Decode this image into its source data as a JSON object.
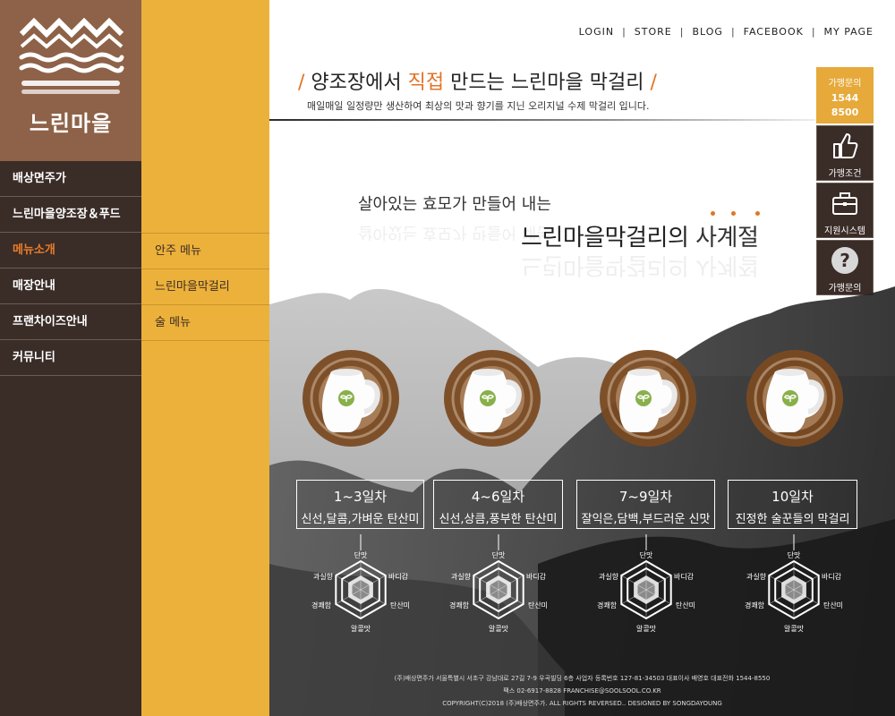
{
  "brand": {
    "logo_text": "느린마을"
  },
  "top_links": [
    "LOGIN",
    "STORE",
    "BLOG",
    "FACEBOOK",
    "MY PAGE"
  ],
  "main_nav": [
    {
      "label": "배상면주가",
      "active": false
    },
    {
      "label": "느린마을양조장＆푸드",
      "active": false
    },
    {
      "label": "메뉴소개",
      "active": true
    },
    {
      "label": "매장안내",
      "active": false
    },
    {
      "label": "프랜차이즈안내",
      "active": false
    },
    {
      "label": "커뮤니티",
      "active": false
    }
  ],
  "sub_nav": [
    "안주 메뉴",
    "느린마을막걸리",
    "술 메뉴"
  ],
  "headline": {
    "slash": "/",
    "part1": "양조장에서 ",
    "highlight": "직접",
    "part2": " 만드는 느린마을 막걸리",
    "sub": "매일매일 일정량만 생산하여 최상의 맛과 향기를 지닌 오리지널 수제 막걸리 입니다."
  },
  "quick": {
    "call_label": "가맹문의",
    "call_number_1": "1544",
    "call_number_2": "8500",
    "buttons": [
      {
        "label": "가맹조건",
        "icon": "thumbs-up-icon"
      },
      {
        "label": "지원시스템",
        "icon": "briefcase-icon"
      },
      {
        "label": "가맹문의",
        "icon": "question-icon"
      }
    ]
  },
  "tagline": {
    "line1": "살아있는 효모가 만들어 내는",
    "line2a": "느린마을막걸리의 ",
    "line2b": "사계절"
  },
  "stages": [
    {
      "day": "1~3일차",
      "desc": "신선,달콤,가벼운 탄산미"
    },
    {
      "day": "4~6일차",
      "desc": "신선,상큼,풍부한 탄산미"
    },
    {
      "day": "7~9일차",
      "desc": "잘익은,담백,부드러운 신맛"
    },
    {
      "day": "10일차",
      "desc": "진정한 술꾼들의 막걸리"
    }
  ],
  "radar_labels": {
    "top": "단맛",
    "top_left": "과실향",
    "top_right": "바디감",
    "bottom_left": "경쾌함",
    "bottom_right": "탄산미",
    "bottom": "알콜맛"
  },
  "footer": {
    "line1": "(주)배상면주가 서울특별시 서초구 강남대로 27길 7-9 우곡빌딩 6층 사업자 등록번호 127-81-34503 대표이사 배영호 대표전화 1544-8550",
    "line2": "팩스 02-6917-8828  FRANCHISE@SOOLSOOL.CO.KR",
    "line3": "COPYRIGHT(C)2018 (주)배상면주가. ALL RIGHTS REVERSED.. DESIGNED BY SONGDAYOUNG"
  },
  "colors": {
    "accent": "#e27427",
    "sidebar": "#3a2c27",
    "logo_bg": "#8e6248",
    "subnav": "#ecb13a",
    "jug_ink": "#7a4a22"
  }
}
